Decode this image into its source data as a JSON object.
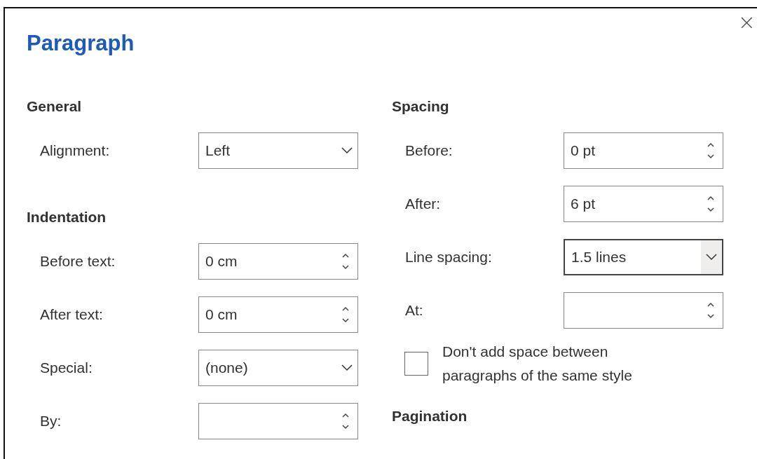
{
  "dialog": {
    "title": "Paragraph",
    "close": "×"
  },
  "columns": [
    {
      "items": [
        {
          "kind": "heading",
          "text": "General"
        },
        {
          "kind": "dropdown",
          "label": "Alignment:",
          "value": "Left",
          "focused": false
        },
        {
          "kind": "heading",
          "text": "Indentation"
        },
        {
          "kind": "spinner",
          "label": "Before text:",
          "value": "0 cm",
          "focused": false
        },
        {
          "kind": "spinner",
          "label": "After text:",
          "value": "0 cm",
          "focused": false
        },
        {
          "kind": "dropdown",
          "label": "Special:",
          "value": "(none)",
          "focused": false
        },
        {
          "kind": "spinner",
          "label": "By:",
          "value": "",
          "focused": false
        }
      ]
    },
    {
      "items": [
        {
          "kind": "heading",
          "text": "Spacing"
        },
        {
          "kind": "spinner",
          "label": "Before:",
          "value": "0 pt",
          "focused": false
        },
        {
          "kind": "spinner",
          "label": "After:",
          "value": "6 pt",
          "focused": false
        },
        {
          "kind": "dropdown",
          "label": "Line spacing:",
          "value": "1.5 lines",
          "focused": true
        },
        {
          "kind": "spinner",
          "label": "At:",
          "value": "",
          "focused": false
        },
        {
          "kind": "checkbox",
          "label": "Don't add space between paragraphs of the same style",
          "checked": false
        },
        {
          "kind": "heading",
          "text": "Pagination"
        }
      ]
    }
  ]
}
